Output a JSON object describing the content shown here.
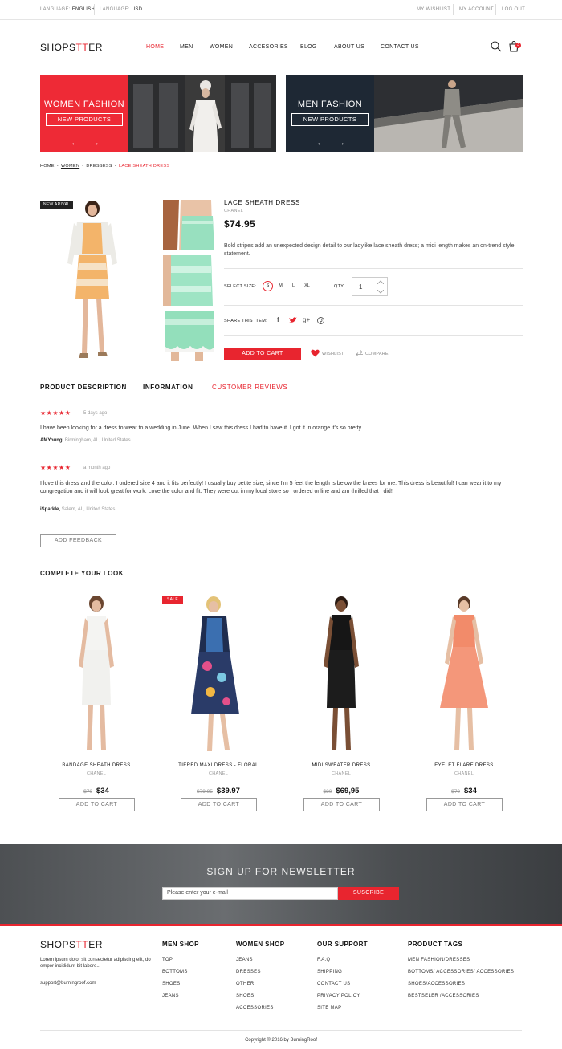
{
  "topbar": {
    "language_label": "LANGUAGE:",
    "language_value": "ENGLISH",
    "currency_label": "LANGUAGE:",
    "currency_value": "USD",
    "wishlist": "MY WISHLIST",
    "account": "MY ACCOUNT",
    "logout": "LOG OUT"
  },
  "header": {
    "logo_a": "SHOPS",
    "logo_b": "TT",
    "logo_c": "ER",
    "nav": [
      "HOME",
      "MEN",
      "WOMEN",
      "ACCESORIES",
      "BLOG",
      "ABOUT US",
      "CONTACT US"
    ],
    "active_nav": "HOME",
    "cart_count": "3",
    "icons": {
      "search": "search-icon",
      "cart": "shopping-bag-icon"
    }
  },
  "banners": [
    {
      "title": "WOMEN FASHION",
      "button": "NEW PRODUCTS",
      "prev": "←",
      "next": "→",
      "panel_color": "#ee2a36"
    },
    {
      "title": "MEN FASHION",
      "button": "NEW PRODUCTS",
      "prev": "←",
      "next": "→",
      "panel_color": "#1e2834"
    }
  ],
  "breadcrumb": [
    "HOME",
    "WOMEN",
    "DRESSESS",
    "LACE SHEATH DRESS"
  ],
  "product": {
    "tag": "NEW ARIVAL",
    "name": "LACE SHEATH DRESS",
    "brand": "CHANEL",
    "price": "$74.95",
    "description": "Bold stripes add an unexpected design detail to our ladylike lace sheath dress; a midi length makes an on-trend style statement.",
    "size_label": "SELECT SIZE:",
    "sizes": [
      "S",
      "M",
      "L",
      "XL"
    ],
    "selected_size": "S",
    "qty_label": "QTY:",
    "qty": "1",
    "share_label": "SHARE THIS ITEM:",
    "share_icons": [
      "facebook-icon",
      "twitter-icon",
      "google-plus-icon",
      "pinterest-icon"
    ],
    "add_to_cart": "ADD TO CART",
    "wishlist": "WISHLIST",
    "compare": "COMPARE"
  },
  "tabs": [
    "PRODUCT DESCRIPTION",
    "INFORMATION",
    "CUSTOMER REVIEWS"
  ],
  "active_tab": "CUSTOMER REVIEWS",
  "reviews": [
    {
      "stars": "★★★★★",
      "date": "5 days ago",
      "text": "I have been looking for a dress to wear to a wedding in June. When I saw this dress I had to have it. I got it in orange it's so pretty.",
      "author": "AMYoung,",
      "location": "Birmingham, AL, United States"
    },
    {
      "stars": "★★★★★",
      "date": "a month ago",
      "text": "I love this dress and the color. I ordered size 4 and it fits perfectly! I usually buy petite size, since I'm 5 feet the length is below the knees for me. This dress is beautiful! I can wear it to my congregation and it will look great for work. Love the color and fit. They were out in my local store so I ordered online and am thrilled that I did!",
      "author": "iSparkle,",
      "location": "Salem, AL, United States"
    }
  ],
  "add_feedback": "ADD FEEDBACK",
  "related_title": "COMPLETE YOUR LOOK",
  "related": [
    {
      "name": "BANDAGE SHEATH DRESS",
      "brand": "CHANEL",
      "old_price": "$70",
      "price": "$34",
      "button": "ADD TO CART",
      "sale": ""
    },
    {
      "name": "TIERED MAXI DRESS - FLORAL",
      "brand": "CHANEL",
      "old_price": "$79.95",
      "price": "$39.97",
      "button": "ADD TO CART",
      "sale": "SALE"
    },
    {
      "name": "MIDI SWEATER DRESS",
      "brand": "CHANEL",
      "old_price": "$80",
      "price": "$69,95",
      "button": "ADD TO CART",
      "sale": ""
    },
    {
      "name": "EYELET FLARE DRESS",
      "brand": "CHANEL",
      "old_price": "$70",
      "price": "$34",
      "button": "ADD TO CART",
      "sale": ""
    }
  ],
  "newsletter": {
    "title": "SIGN UP FOR NEWSLETTER",
    "placeholder": "Please enter your e-mail",
    "button": "SUSCRIBE"
  },
  "footer": {
    "about": "Lorem ipsum dolor sit consectetur adipiscing elit, do empor incididunt bit labore...",
    "email": "support@burningroof.com",
    "columns": [
      {
        "title": "MEN SHOP",
        "links": [
          "TOP",
          "BOTTOMS",
          "SHOES",
          "JEANS"
        ]
      },
      {
        "title": "WOMEN SHOP",
        "links": [
          "JEANS",
          "DRESSES",
          "OTHER",
          "SHOES",
          "ACCESSORIES"
        ]
      },
      {
        "title": "OUR SUPPORT",
        "links": [
          "F.A.Q",
          "SHIPPING",
          "CONTACT US",
          "PRIVACY POLICY",
          "SITE MAP"
        ]
      },
      {
        "title": "PRODUCT TAGS",
        "links": [
          "MEN FASHION/DRESSES",
          "BOTTOMS/ ACCESSORIES/ ACCESSORIES",
          "SHOES/ACCESSORIES",
          "BESTSELER /ACCESSORIES"
        ]
      }
    ],
    "copyright": "Copyright © 2016 by BurningRoof"
  }
}
